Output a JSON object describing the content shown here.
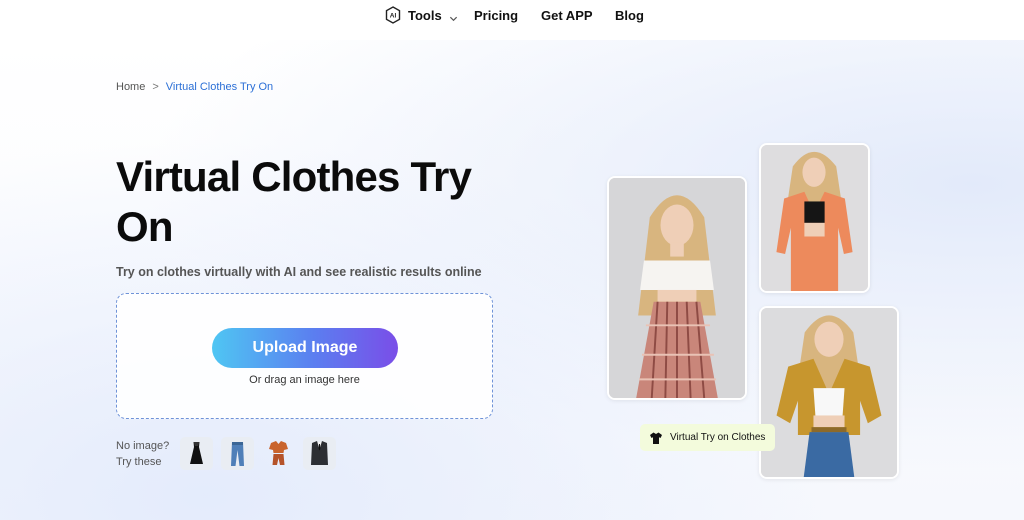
{
  "nav": {
    "tools_label": "Tools",
    "pricing_label": "Pricing",
    "getapp_label": "Get APP",
    "blog_label": "Blog"
  },
  "breadcrumb": {
    "home": "Home",
    "separator": ">",
    "current": "Virtual Clothes Try On"
  },
  "hero": {
    "title": "Virtual Clothes Try On",
    "subtitle": "Try on clothes virtually with AI and see realistic results online"
  },
  "upload": {
    "button_label": "Upload Image",
    "drag_text": "Or drag an image here"
  },
  "samples": {
    "no_image_line1": "No image?",
    "no_image_line2": "Try these",
    "items": [
      "black-dress-icon",
      "jeans-icon",
      "orange-outfit-icon",
      "suit-icon"
    ]
  },
  "preview": {
    "tag_label": "Virtual Try on Clothes"
  },
  "colors": {
    "accent_blue": "#2b6fd6",
    "button_gradient_start": "#4fc6f3",
    "button_gradient_end": "#7a4ee8",
    "upload_border": "#6f93d8",
    "tag_bg": "#f3fbdc"
  }
}
